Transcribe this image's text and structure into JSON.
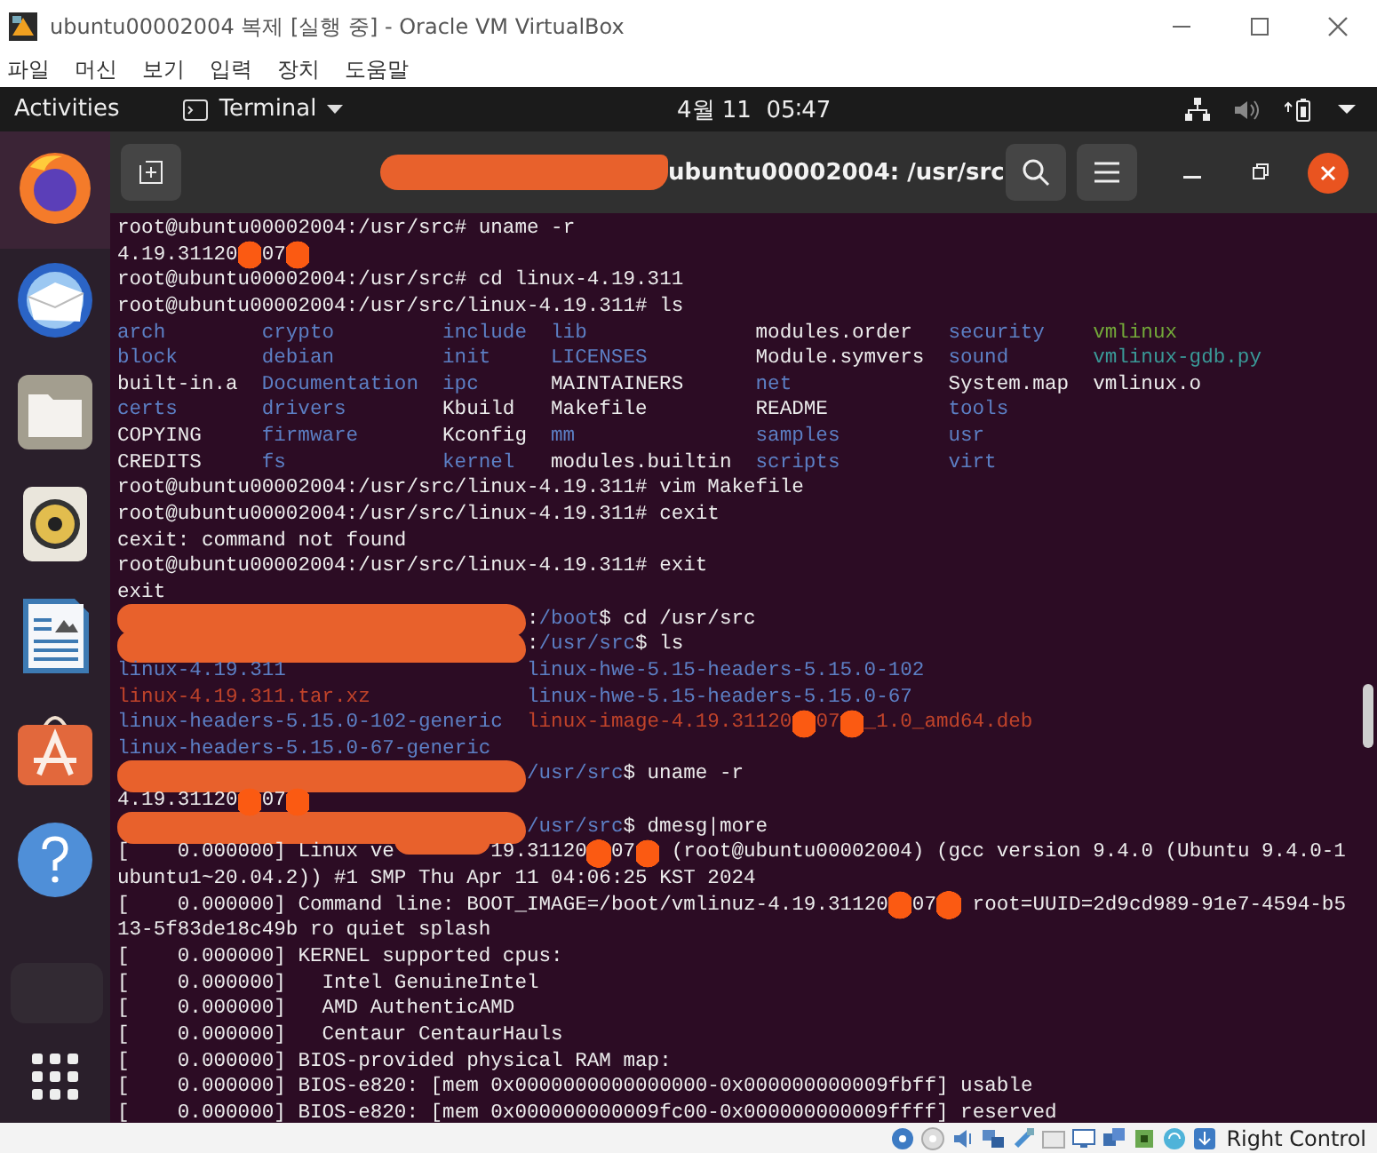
{
  "window": {
    "title": "ubuntu00002004 복제 [실행 중] - Oracle VM VirtualBox"
  },
  "menu": [
    "파일",
    "머신",
    "보기",
    "입력",
    "장치",
    "도움말"
  ],
  "top_bar": {
    "activities": "Activities",
    "app": "Terminal",
    "clock": "4월 11  05∶47"
  },
  "terminal": {
    "title": "ubuntu00002004: /usr/src",
    "title_redacted": true,
    "lines": [
      {
        "kind": "line",
        "parts": [
          {
            "kind": "plain",
            "text": "root@ubuntu00002004:/usr/src# uname -r"
          }
        ]
      },
      {
        "kind": "line",
        "parts": [
          {
            "kind": "plain",
            "text": "4.19.31120"
          },
          {
            "kind": "dot"
          },
          {
            "kind": "plain",
            "text": "07"
          },
          {
            "kind": "dot"
          }
        ]
      },
      {
        "kind": "line",
        "parts": [
          {
            "kind": "plain",
            "text": "root@ubuntu00002004:/usr/src# cd linux-4.19.311"
          }
        ]
      },
      {
        "kind": "line",
        "parts": [
          {
            "kind": "plain",
            "text": "root@ubuntu00002004:/usr/src/linux-4.19.311# ls"
          }
        ]
      },
      {
        "kind": "listing",
        "columns": [
          [
            {
              "kind": "dir",
              "text": "arch"
            },
            {
              "kind": "dir",
              "text": "block"
            },
            {
              "kind": "plain",
              "text": "built-in.a"
            },
            {
              "kind": "dir",
              "text": "certs"
            },
            {
              "kind": "plain",
              "text": "COPYING"
            },
            {
              "kind": "plain",
              "text": "CREDITS"
            }
          ],
          [
            {
              "kind": "dir",
              "text": "crypto"
            },
            {
              "kind": "dir",
              "text": "debian"
            },
            {
              "kind": "dir",
              "text": "Documentation"
            },
            {
              "kind": "dir",
              "text": "drivers"
            },
            {
              "kind": "dir",
              "text": "firmware"
            },
            {
              "kind": "dir",
              "text": "fs"
            }
          ],
          [
            {
              "kind": "dir",
              "text": "include"
            },
            {
              "kind": "dir",
              "text": "init"
            },
            {
              "kind": "dir",
              "text": "ipc"
            },
            {
              "kind": "plain",
              "text": "Kbuild"
            },
            {
              "kind": "plain",
              "text": "Kconfig"
            },
            {
              "kind": "dir",
              "text": "kernel"
            }
          ],
          [
            {
              "kind": "dir",
              "text": "lib"
            },
            {
              "kind": "dir",
              "text": "LICENSES"
            },
            {
              "kind": "plain",
              "text": "MAINTAINERS"
            },
            {
              "kind": "plain",
              "text": "Makefile"
            },
            {
              "kind": "dir",
              "text": "mm"
            },
            {
              "kind": "plain",
              "text": "modules.builtin"
            }
          ],
          [
            {
              "kind": "plain",
              "text": "modules.order"
            },
            {
              "kind": "plain",
              "text": "Module.symvers"
            },
            {
              "kind": "dir",
              "text": "net"
            },
            {
              "kind": "plain",
              "text": "README"
            },
            {
              "kind": "dir",
              "text": "samples"
            },
            {
              "kind": "dir",
              "text": "scripts"
            }
          ],
          [
            {
              "kind": "dir",
              "text": "security"
            },
            {
              "kind": "dir",
              "text": "sound"
            },
            {
              "kind": "plain",
              "text": "System.map"
            },
            {
              "kind": "dir",
              "text": "tools"
            },
            {
              "kind": "dir",
              "text": "usr"
            },
            {
              "kind": "dir",
              "text": "virt"
            }
          ],
          [
            {
              "kind": "exec",
              "text": "vmlinux"
            },
            {
              "kind": "link",
              "text": "vmlinux-gdb.py"
            },
            {
              "kind": "plain",
              "text": "vmlinux.o"
            }
          ]
        ]
      },
      {
        "kind": "line",
        "parts": [
          {
            "kind": "plain",
            "text": "root@ubuntu00002004:/usr/src/linux-4.19.311# vim Makefile"
          }
        ]
      },
      {
        "kind": "line",
        "parts": [
          {
            "kind": "plain",
            "text": "root@ubuntu00002004:/usr/src/linux-4.19.311# cexit"
          }
        ]
      },
      {
        "kind": "line",
        "parts": [
          {
            "kind": "plain",
            "text": "cexit: command not found"
          }
        ]
      },
      {
        "kind": "line",
        "parts": [
          {
            "kind": "plain",
            "text": "root@ubuntu00002004:/usr/src/linux-4.19.311# exit"
          }
        ]
      },
      {
        "kind": "line",
        "parts": [
          {
            "kind": "plain",
            "text": "exit"
          }
        ]
      },
      {
        "kind": "line",
        "parts": [
          {
            "kind": "smear"
          },
          {
            "kind": "plain",
            "text": ":"
          },
          {
            "kind": "dir",
            "text": "/boot"
          },
          {
            "kind": "plain",
            "text": "$ cd /usr/src"
          }
        ]
      },
      {
        "kind": "line",
        "parts": [
          {
            "kind": "smear"
          },
          {
            "kind": "plain",
            "text": ":"
          },
          {
            "kind": "dir",
            "text": "/usr/src"
          },
          {
            "kind": "plain",
            "text": "$ ls"
          }
        ]
      },
      {
        "kind": "listing",
        "columns": [
          [
            {
              "kind": "dir",
              "text": "linux-4.19.311"
            },
            {
              "kind": "archive",
              "text": "linux-4.19.311.tar.xz"
            },
            {
              "kind": "dir",
              "text": "linux-headers-5.15.0-102-generic"
            },
            {
              "kind": "dir",
              "text": "linux-headers-5.15.0-67-generic"
            }
          ],
          [
            {
              "kind": "dir",
              "text": "linux-hwe-5.15-headers-5.15.0-102"
            },
            {
              "kind": "dir",
              "text": "linux-hwe-5.15-headers-5.15.0-67"
            },
            {
              "parts": [
                {
                  "kind": "archive",
                  "text": "linux-image-4.19.31120"
                },
                {
                  "kind": "dot"
                },
                {
                  "kind": "archive",
                  "text": "07"
                },
                {
                  "kind": "dot"
                },
                {
                  "kind": "archive",
                  "text": "_1.0_amd64.deb"
                }
              ]
            }
          ]
        ]
      },
      {
        "kind": "line",
        "parts": [
          {
            "kind": "smear"
          },
          {
            "kind": "dir",
            "text": "/usr/src"
          },
          {
            "kind": "plain",
            "text": "$ uname -r"
          }
        ]
      },
      {
        "kind": "line",
        "parts": [
          {
            "kind": "plain",
            "text": "4.19.31120"
          },
          {
            "kind": "dot"
          },
          {
            "kind": "plain",
            "text": "07"
          },
          {
            "kind": "dot"
          }
        ]
      },
      {
        "kind": "line",
        "parts": [
          {
            "kind": "smear"
          },
          {
            "kind": "dir",
            "text": "/usr/src"
          },
          {
            "kind": "plain",
            "text": "$ dmesg|more"
          }
        ]
      },
      {
        "kind": "line",
        "parts": [
          {
            "kind": "plain",
            "text": "[    0.000000] Linux ve"
          },
          {
            "kind": "smudge"
          },
          {
            "kind": "plain",
            "text": "19.31120"
          },
          {
            "kind": "dot"
          },
          {
            "kind": "plain",
            "text": "07"
          },
          {
            "kind": "dot"
          },
          {
            "kind": "plain",
            "text": " (root@ubuntu00002004) (gcc version 9.4.0 (Ubuntu 9.4.0-1"
          }
        ]
      },
      {
        "kind": "line",
        "parts": [
          {
            "kind": "plain",
            "text": "ubuntu1~20.04.2)) #1 SMP Thu Apr 11 04:06:25 KST 2024"
          }
        ]
      },
      {
        "kind": "line",
        "parts": [
          {
            "kind": "plain",
            "text": "[    0.000000] Command line: BOOT_IMAGE=/boot/vmlinuz-4.19.31120"
          },
          {
            "kind": "dot"
          },
          {
            "kind": "plain",
            "text": "07"
          },
          {
            "kind": "dot"
          },
          {
            "kind": "plain",
            "text": " root=UUID=2d9cd989-91e7-4594-b5"
          }
        ]
      },
      {
        "kind": "line",
        "parts": [
          {
            "kind": "plain",
            "text": "13-5f83de18c49b ro quiet splash"
          }
        ]
      },
      {
        "kind": "line",
        "parts": [
          {
            "kind": "plain",
            "text": "[    0.000000] KERNEL supported cpus:"
          }
        ]
      },
      {
        "kind": "line",
        "parts": [
          {
            "kind": "plain",
            "text": "[    0.000000]   Intel GenuineIntel"
          }
        ]
      },
      {
        "kind": "line",
        "parts": [
          {
            "kind": "plain",
            "text": "[    0.000000]   AMD AuthenticAMD"
          }
        ]
      },
      {
        "kind": "line",
        "parts": [
          {
            "kind": "plain",
            "text": "[    0.000000]   Centaur CentaurHauls"
          }
        ]
      },
      {
        "kind": "line",
        "parts": [
          {
            "kind": "plain",
            "text": "[    0.000000] BIOS-provided physical RAM map:"
          }
        ]
      },
      {
        "kind": "line",
        "parts": [
          {
            "kind": "plain",
            "text": "[    0.000000] BIOS-e820: [mem 0x0000000000000000-0x000000000009fbff] usable"
          }
        ]
      },
      {
        "kind": "line",
        "parts": [
          {
            "kind": "plain",
            "text": "[    0.000000] BIOS-e820: [mem 0x000000000009fc00-0x000000000009ffff] reserved"
          }
        ]
      }
    ]
  },
  "status_bar": {
    "host_key": "Right Control"
  }
}
